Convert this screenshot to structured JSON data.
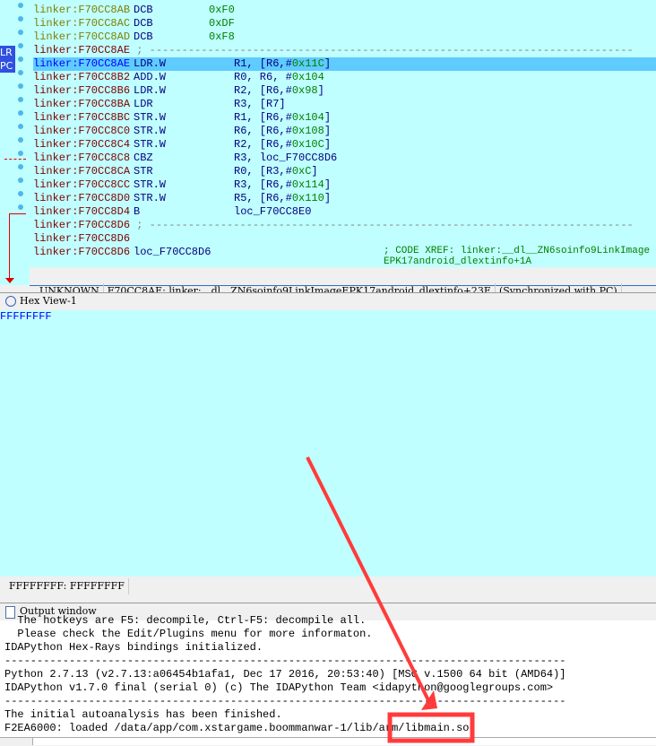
{
  "disasm": {
    "lines": [
      {
        "addr": "linker:F70CC8AB",
        "mn": "DCB",
        "op": "",
        "num": "0xF0",
        "kind": "d"
      },
      {
        "addr": "linker:F70CC8AC",
        "mn": "DCB",
        "op": "",
        "num": "0xDF",
        "kind": "d"
      },
      {
        "addr": "linker:F70CC8AD",
        "mn": "DCB",
        "op": "",
        "num": "0xF8",
        "kind": "d"
      },
      {
        "addr": "linker:F70CC8AE",
        "sep": "; ---------------------------------------------------------------------------",
        "kind": "c"
      },
      {
        "addr": "linker:F70CC8AE",
        "mn": "LDR.W",
        "op": "R1, [R6,#0x11C]",
        "kind": "h"
      },
      {
        "addr": "linker:F70CC8B2",
        "mn": "ADD.W",
        "op": "R0, R6, #0x104",
        "kind": "c"
      },
      {
        "addr": "linker:F70CC8B6",
        "mn": "LDR.W",
        "op": "R2, [R6,#0x98]",
        "kind": "c"
      },
      {
        "addr": "linker:F70CC8BA",
        "mn": "LDR",
        "op": "R3, [R7]",
        "kind": "c"
      },
      {
        "addr": "linker:F70CC8BC",
        "mn": "STR.W",
        "op": "R1, [R6,#0x104]",
        "kind": "c"
      },
      {
        "addr": "linker:F70CC8C0",
        "mn": "STR.W",
        "op": "R6, [R6,#0x108]",
        "kind": "c"
      },
      {
        "addr": "linker:F70CC8C4",
        "mn": "STR.W",
        "op": "R2, [R6,#0x10C]",
        "kind": "c"
      },
      {
        "addr": "linker:F70CC8C8",
        "mn": "CBZ",
        "op": "R3, loc_F70CC8D6",
        "kind": "c"
      },
      {
        "addr": "linker:F70CC8CA",
        "mn": "STR",
        "op": "R0, [R3,#0xC]",
        "kind": "c"
      },
      {
        "addr": "linker:F70CC8CC",
        "mn": "STR.W",
        "op": "R3, [R6,#0x114]",
        "kind": "c"
      },
      {
        "addr": "linker:F70CC8D0",
        "mn": "STR.W",
        "op": "R5, [R6,#0x110]",
        "kind": "c"
      },
      {
        "addr": "linker:F70CC8D4",
        "mn": "B",
        "op": "loc_F70CC8E0",
        "kind": "c"
      },
      {
        "addr": "linker:F70CC8D6",
        "sep": "; ---------------------------------------------------------------------------",
        "kind": "c"
      },
      {
        "addr": "linker:F70CC8D6",
        "kind": "c"
      },
      {
        "addr": "linker:F70CC8D6",
        "mn": "loc_F70CC8D6",
        "cmt": "; CODE XREF: linker:__dl__ZN6soinfo9LinkImageEPK17android_dlextinfo+1A",
        "kind": "c"
      }
    ],
    "lr_label": "LR",
    "pc_label": "PC",
    "status": [
      "UNKNOWN",
      "F70CC8AE: linker:__dl__ZN6soinfo9LinkImageEPK17android_dlextinfo+23E",
      "(Synchronized with PC)"
    ]
  },
  "hex": {
    "title": "Hex View-1",
    "content": "FFFFFFFF",
    "status": "FFFFFFFF: FFFFFFFF"
  },
  "output": {
    "title": "Output window",
    "lines": [
      "  The hotkeys are F5: decompile, Ctrl-F5: decompile all.",
      "  Please check the Edit/Plugins menu for more informaton.",
      "IDAPython Hex-Rays bindings initialized.",
      "---------------------------------------------------------------------------------------",
      "Python 2.7.13 (v2.7.13:a06454b1afa1, Dec 17 2016, 20:53:40) [MSC v.1500 64 bit (AMD64)]",
      "IDAPython v1.7.0 final (serial 0) (c) The IDAPython Team <idapython@googlegroups.com>",
      "---------------------------------------------------------------------------------------",
      "The initial autoanalysis has been finished.",
      "F2EA6000: loaded /data/app/com.xstargame.boommanwar-1/lib/arm/libmain.so"
    ]
  },
  "annotation_color": "#ff3b3b"
}
